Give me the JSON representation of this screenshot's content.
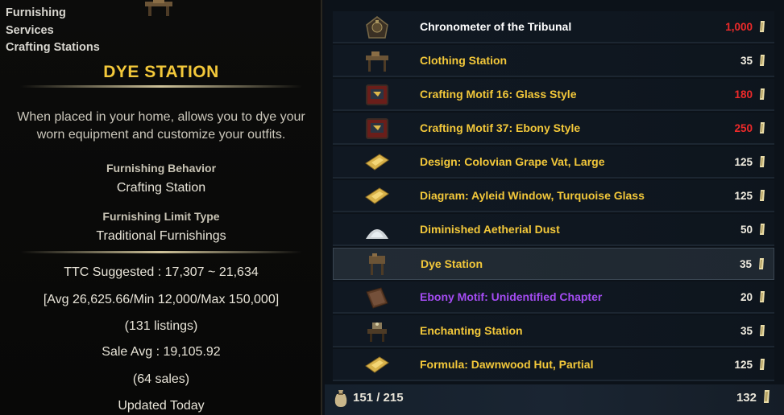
{
  "tooltip": {
    "categories": [
      "Furnishing",
      "Services",
      "Crafting Stations"
    ],
    "title": "DYE STATION",
    "description": "When placed in your home, allows you to dye your worn equipment and customize your outfits.",
    "behavior_label": "Furnishing Behavior",
    "behavior_value": "Crafting Station",
    "limit_label": "Furnishing Limit Type",
    "limit_value": "Traditional Furnishings",
    "ttc_suggested": "TTC Suggested : 17,307 ~ 21,634",
    "ttc_stats": "[Avg 26,625.66/Min 12,000/Max 150,000]",
    "listings": "(131 listings)",
    "sale_avg": "Sale Avg : 19,105.92",
    "sales": "(64 sales)",
    "updated": "Updated Today"
  },
  "items": [
    {
      "name": "Chronometer of the Tribunal",
      "price": "1,000",
      "name_color": "white",
      "price_red": true,
      "icon": "chronometer-icon"
    },
    {
      "name": "Clothing Station",
      "price": "35",
      "name_color": "gold",
      "price_red": false,
      "icon": "clothing-station-icon"
    },
    {
      "name": "Crafting Motif 16: Glass Style",
      "price": "180",
      "name_color": "gold",
      "price_red": true,
      "icon": "motif-book-icon"
    },
    {
      "name": "Crafting Motif 37: Ebony Style",
      "price": "250",
      "name_color": "gold",
      "price_red": true,
      "icon": "motif-book-icon"
    },
    {
      "name": "Design: Colovian Grape Vat, Large",
      "price": "125",
      "name_color": "gold",
      "price_red": false,
      "icon": "blueprint-icon"
    },
    {
      "name": "Diagram: Ayleid Window, Turquoise Glass",
      "price": "125",
      "name_color": "gold",
      "price_red": false,
      "icon": "blueprint-icon"
    },
    {
      "name": "Diminished Aetherial Dust",
      "price": "50",
      "name_color": "gold",
      "price_red": false,
      "icon": "dust-pile-icon"
    },
    {
      "name": "Dye Station",
      "price": "35",
      "name_color": "gold",
      "price_red": false,
      "icon": "dye-station-icon"
    },
    {
      "name": "Ebony Motif: Unidentified Chapter",
      "price": "20",
      "name_color": "purple",
      "price_red": false,
      "icon": "chapter-book-icon"
    },
    {
      "name": "Enchanting Station",
      "price": "35",
      "name_color": "gold",
      "price_red": false,
      "icon": "enchanting-station-icon"
    },
    {
      "name": "Formula: Dawnwood Hut, Partial",
      "price": "125",
      "name_color": "gold",
      "price_red": false,
      "icon": "blueprint-icon"
    }
  ],
  "selected_index": 7,
  "footer": {
    "bag_count": "151 / 215",
    "gold": "132"
  },
  "colors": {
    "gold_text": "#f3c83a",
    "red_price": "#ee2a2a",
    "purple_text": "#a44cf2"
  }
}
